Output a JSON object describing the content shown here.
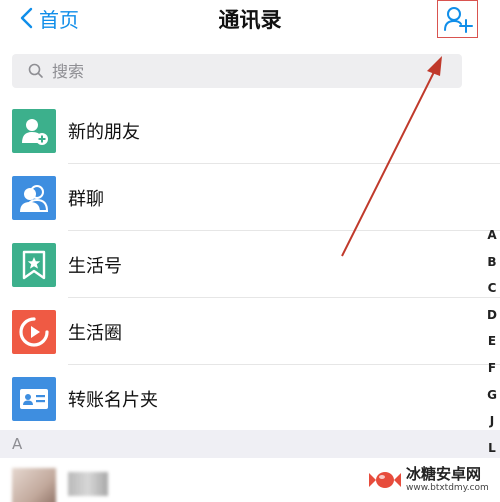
{
  "nav": {
    "back_label": "首页",
    "title": "通讯录",
    "add_icon": "add-user-icon",
    "accent_color": "#108ee9",
    "highlight_color": "#d9534f"
  },
  "search": {
    "placeholder": "搜索",
    "value": ""
  },
  "list": {
    "items": [
      {
        "label": "新的朋友",
        "icon": "new-friend-icon",
        "color": "#3cb08c"
      },
      {
        "label": "群聊",
        "icon": "group-chat-icon",
        "color": "#3e8ee0"
      },
      {
        "label": "生活号",
        "icon": "lifestyle-account-icon",
        "color": "#3cb08c"
      },
      {
        "label": "生活圈",
        "icon": "life-circle-icon",
        "color": "#ef5a44"
      },
      {
        "label": "转账名片夹",
        "icon": "business-card-icon",
        "color": "#3e8ee0"
      }
    ]
  },
  "section": {
    "header": "A"
  },
  "index": {
    "letters": [
      "A",
      "B",
      "C",
      "D",
      "E",
      "F",
      "G",
      "J",
      "L"
    ]
  },
  "watermark": {
    "title": "冰糖安卓网",
    "url": "www.btxtdmy.com"
  }
}
